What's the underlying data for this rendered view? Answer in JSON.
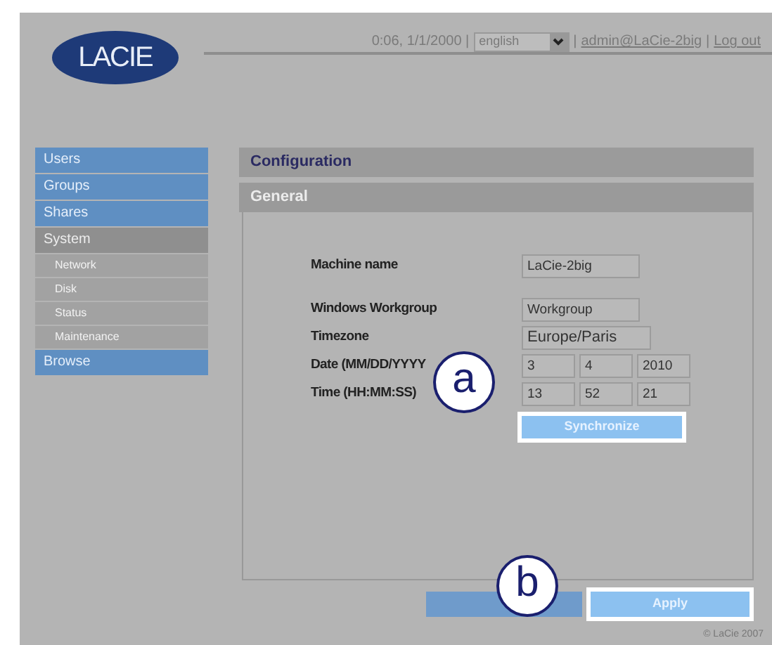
{
  "logo": "LACIE",
  "header": {
    "clock": "0:06, 1/1/2000 |",
    "language": {
      "value": "english"
    },
    "separator": "|",
    "user": "admin@LaCie-2big",
    "separator_2": "|",
    "logout": "Log out"
  },
  "sidebar": {
    "items": [
      {
        "label": "Users",
        "expanded": false
      },
      {
        "label": "Groups",
        "expanded": false
      },
      {
        "label": "Shares",
        "expanded": false
      },
      {
        "label": "System",
        "expanded": true,
        "children": [
          {
            "label": "Network"
          },
          {
            "label": "Disk"
          },
          {
            "label": "Status"
          },
          {
            "label": "Maintenance"
          }
        ]
      },
      {
        "label": "Browse",
        "expanded": false
      }
    ]
  },
  "panel": {
    "title": "Configuration",
    "section": "General"
  },
  "form": [
    {
      "kind": "text",
      "label": "Machine name",
      "values": [
        "LaCie-2big"
      ]
    },
    {
      "kind": "text",
      "label": "Windows Workgroup",
      "values": [
        "Workgroup"
      ]
    },
    {
      "kind": "wide",
      "label": "Timezone",
      "values": [
        "Europe/Paris"
      ]
    },
    {
      "kind": "triple",
      "label": "Date (MM/DD/YYYY",
      "values": [
        "3",
        "4",
        "2010"
      ]
    },
    {
      "kind": "triple",
      "label": "Time (HH:MM:SS)",
      "values": [
        "13",
        "52",
        "21"
      ]
    }
  ],
  "synchronize": {
    "label": "Synchronize",
    "highlighted": true
  },
  "apply": {
    "label": "Apply",
    "highlighted": true
  },
  "callouts": [
    "a",
    "b"
  ],
  "copyright": "© LaCie 2007"
}
